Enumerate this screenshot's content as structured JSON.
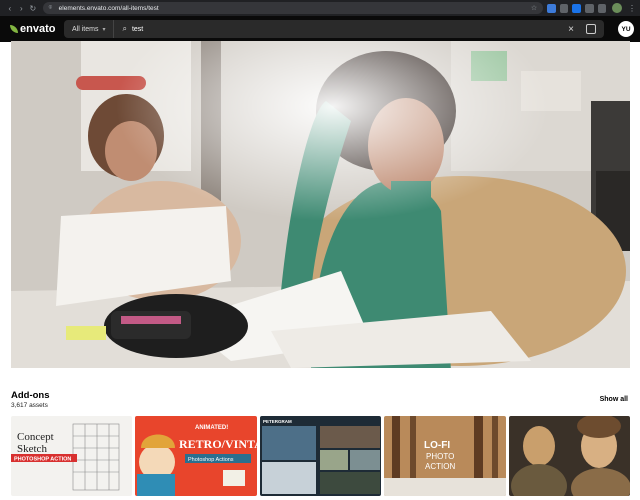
{
  "browser": {
    "url": "elements.envato.com/all-items/test",
    "back_icon": "back-arrow-icon",
    "forward_icon": "forward-arrow-icon",
    "reload_icon": "reload-icon"
  },
  "header": {
    "logo_text": "envato",
    "filter_label": "All items",
    "search_value": "test",
    "avatar_initials": "YU"
  },
  "section": {
    "title": "Add-ons",
    "count": "3,617 assets",
    "show_all": "Show all"
  },
  "thumbnails": [
    {
      "title_line1": "Concept",
      "title_line2": "Sketch",
      "banner": "PHOTOSHOP ACTION"
    },
    {
      "badge": "ANIMATED!",
      "title": "RETRO/VINTAGE",
      "subtitle": "Photoshop Actions"
    },
    {
      "label": "PETERGRAM"
    },
    {
      "title_line1": "LO-FI",
      "title_line2": "PHOTO",
      "title_line3": "ACTION"
    },
    {
      "label": ""
    }
  ],
  "colors": {
    "accent": "#82b541",
    "header_bg": "#0a0a0a",
    "retro_bg": "#e8452c"
  }
}
